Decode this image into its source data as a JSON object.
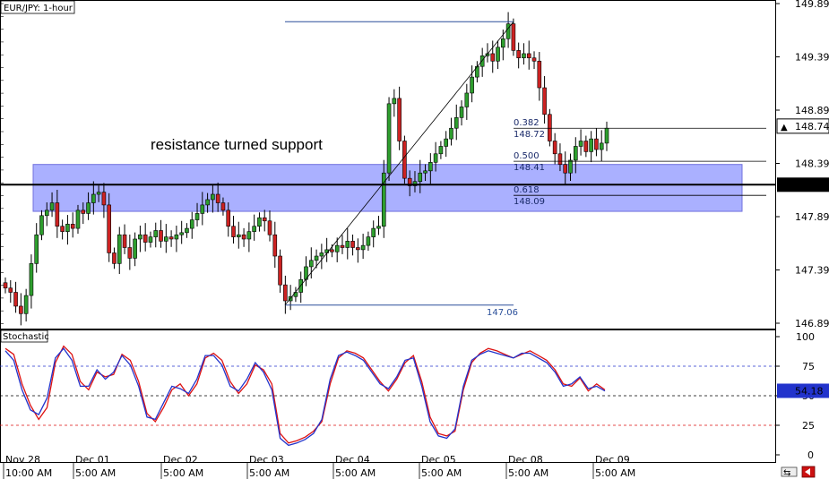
{
  "chart_data": [
    {
      "type": "candlestick",
      "title": "EUR/JPY: 1-hour",
      "ylim": [
        146.82,
        149.93
      ],
      "price_ticks": [
        149.89,
        149.39,
        148.89,
        148.39,
        147.89,
        147.39,
        146.89
      ],
      "current_price": "148.74",
      "support_line_price": "148.19",
      "annotation": "resistance turned support",
      "support_zone": [
        147.94,
        148.38
      ],
      "fibonacci": {
        "high": 149.72,
        "low": 147.06,
        "low_label": "147.06",
        "levels": [
          {
            "ratio": "0.382",
            "price": "148.72",
            "value": 148.72
          },
          {
            "ratio": "0.500",
            "price": "148.41",
            "value": 148.41
          },
          {
            "ratio": "0.618",
            "price": "148.09",
            "value": 148.09
          }
        ]
      },
      "x_date_labels": [
        "Nov 28",
        "Dec 01",
        "Dec 02",
        "Dec 03",
        "Dec 04",
        "Dec 05",
        "Dec 08",
        "Dec 09"
      ],
      "x_time_labels": [
        "10:00 AM",
        "5:00 AM",
        "5:00 AM",
        "5:00 AM",
        "5:00 AM",
        "5:00 AM",
        "5:00 AM",
        "5:00 AM"
      ],
      "closes": [
        147.22,
        147.18,
        147.05,
        146.98,
        147.15,
        147.45,
        147.72,
        147.9,
        147.95,
        148.02,
        147.8,
        147.75,
        147.82,
        147.78,
        147.95,
        147.92,
        148.02,
        148.1,
        148.12,
        148.0,
        147.55,
        147.45,
        147.72,
        147.6,
        147.5,
        147.68,
        147.72,
        147.65,
        147.7,
        147.76,
        147.66,
        147.7,
        147.68,
        147.72,
        147.74,
        147.78,
        147.86,
        147.92,
        148.0,
        148.05,
        148.1,
        148.02,
        147.95,
        147.8,
        147.7,
        147.72,
        147.68,
        147.75,
        147.8,
        147.88,
        147.85,
        147.72,
        147.52,
        147.25,
        147.1,
        147.14,
        147.18,
        147.3,
        147.42,
        147.48,
        147.52,
        147.55,
        147.58,
        147.56,
        147.62,
        147.6,
        147.66,
        147.6,
        147.58,
        147.62,
        147.7,
        147.78,
        147.8,
        148.3,
        148.95,
        149.0,
        148.6,
        148.25,
        148.18,
        148.22,
        148.3,
        148.32,
        148.4,
        148.48,
        148.55,
        148.62,
        148.72,
        148.82,
        148.92,
        149.05,
        149.2,
        149.3,
        149.4,
        149.42,
        149.35,
        149.48,
        149.56,
        149.7,
        149.45,
        149.38,
        149.42,
        149.38,
        149.35,
        149.1,
        148.85,
        148.6,
        148.48,
        148.38,
        148.3,
        148.42,
        148.55,
        148.6,
        148.5,
        148.62,
        148.52,
        148.58,
        148.72
      ]
    },
    {
      "type": "line",
      "title": "Stochastic",
      "ylim": [
        0,
        100
      ],
      "y_ticks": [
        100,
        75,
        50,
        25,
        0
      ],
      "levels": [
        75,
        50,
        25
      ],
      "current_value": "54.18",
      "series": [
        {
          "name": "",
          "color": "#dd1111",
          "values": [
            90,
            85,
            60,
            42,
            30,
            40,
            78,
            92,
            85,
            62,
            55,
            70,
            66,
            68,
            85,
            80,
            62,
            35,
            28,
            40,
            55,
            60,
            50,
            60,
            82,
            86,
            80,
            62,
            52,
            60,
            76,
            72,
            60,
            18,
            10,
            12,
            15,
            20,
            28,
            60,
            82,
            88,
            86,
            82,
            72,
            62,
            54,
            64,
            78,
            84,
            62,
            32,
            18,
            16,
            20,
            55,
            78,
            86,
            90,
            88,
            85,
            82,
            85,
            88,
            84,
            80,
            72,
            60,
            58,
            65,
            54,
            60,
            55
          ]
        },
        {
          "name": "",
          "color": "#2233cc",
          "values": [
            88,
            80,
            55,
            38,
            34,
            48,
            82,
            90,
            80,
            58,
            58,
            72,
            64,
            70,
            84,
            76,
            58,
            32,
            30,
            44,
            58,
            56,
            52,
            64,
            84,
            84,
            76,
            58,
            54,
            64,
            78,
            70,
            55,
            14,
            8,
            10,
            13,
            18,
            30,
            64,
            84,
            87,
            84,
            80,
            70,
            60,
            56,
            66,
            80,
            82,
            58,
            28,
            16,
            14,
            22,
            58,
            80,
            85,
            88,
            86,
            84,
            82,
            86,
            86,
            82,
            78,
            70,
            58,
            60,
            66,
            56,
            58,
            54
          ]
        }
      ]
    }
  ]
}
